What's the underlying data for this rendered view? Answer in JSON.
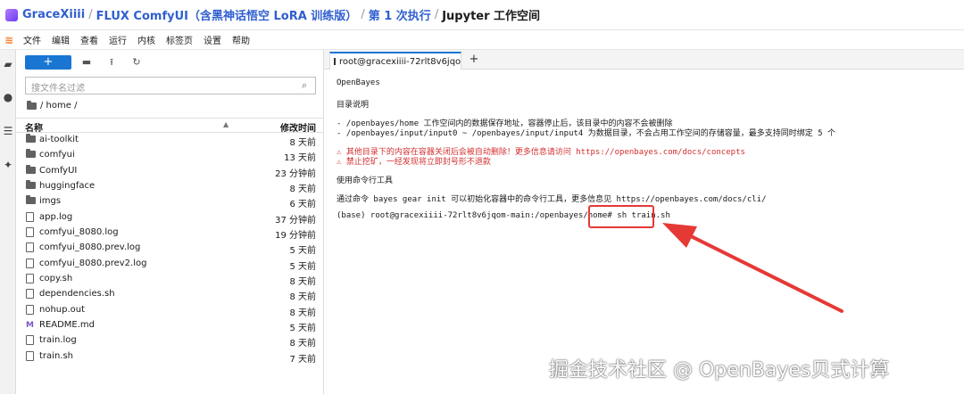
{
  "breadcrumb": {
    "user": "GraceXiiii",
    "project": "FLUX ComfyUI（含黑神话悟空 LoRA 训练版）",
    "run": "第 1 次执行",
    "current": "Jupyter 工作空间",
    "separator": "/"
  },
  "menu": [
    "文件",
    "编辑",
    "查看",
    "运行",
    "内核",
    "标签页",
    "设置",
    "帮助"
  ],
  "filebrowser": {
    "new_label": "+",
    "search_placeholder": "搜文件名过滤",
    "path": "/ home /",
    "col_name": "名称",
    "col_time": "修改时间",
    "items": [
      {
        "name": "ai-toolkit",
        "time": "8 天前",
        "type": "folder"
      },
      {
        "name": "comfyui",
        "time": "13 天前",
        "type": "folder"
      },
      {
        "name": "ComfyUI",
        "time": "23 分钟前",
        "type": "folder"
      },
      {
        "name": "huggingface",
        "time": "8 天前",
        "type": "folder"
      },
      {
        "name": "imgs",
        "time": "6 天前",
        "type": "folder"
      },
      {
        "name": "app.log",
        "time": "37 分钟前",
        "type": "file"
      },
      {
        "name": "comfyui_8080.log",
        "time": "19 分钟前",
        "type": "file"
      },
      {
        "name": "comfyui_8080.prev.log",
        "time": "5 天前",
        "type": "file"
      },
      {
        "name": "comfyui_8080.prev2.log",
        "time": "5 天前",
        "type": "file"
      },
      {
        "name": "copy.sh",
        "time": "8 天前",
        "type": "file"
      },
      {
        "name": "dependencies.sh",
        "time": "8 天前",
        "type": "file"
      },
      {
        "name": "nohup.out",
        "time": "8 天前",
        "type": "file"
      },
      {
        "name": "README.md",
        "time": "5 天前",
        "type": "markdown"
      },
      {
        "name": "train.log",
        "time": "8 天前",
        "type": "file"
      },
      {
        "name": "train.sh",
        "time": "7 天前",
        "type": "file"
      }
    ]
  },
  "terminal_tab": {
    "label": "root@gracexiiii-72rlt8v6jqo",
    "close": "✕",
    "add": "+"
  },
  "terminal": {
    "brand": "OpenBayes",
    "dir_title": "目录说明",
    "dir_line1": "- /openbayes/home 工作空间内的数据保存地址，容器停止后，该目录中的内容不会被删除",
    "dir_line2": "- /openbayes/input/input0 ~ /openbayes/input/input4 为数据目录，不会占用工作空间的存储容量，最多支持同时绑定 5 个",
    "warn1": "⚠  其他目录下的内容在容器关闭后会被自动删除！更多信息请访问 https://openbayes.com/docs/concepts",
    "warn2": "⚠  禁止挖矿，一经发现将立即封号形不退款",
    "tool_title": "使用命令行工具",
    "tool_line": "通过命令 bayes gear init 可以初始化容器中的命令行工具，更多信息见 https://openbayes.com/docs/cli/",
    "prompt": "(base) root@gracexiiii-72rlt8v6jqom-main:/openbayes/home#",
    "command": "sh train.sh"
  },
  "watermark": "掘金技术社区 @ OpenBayes贝式计算",
  "colors": {
    "accent": "#1976d2",
    "link": "#2f5fd0",
    "warning": "#d32f2f",
    "annotation": "#e53935"
  }
}
